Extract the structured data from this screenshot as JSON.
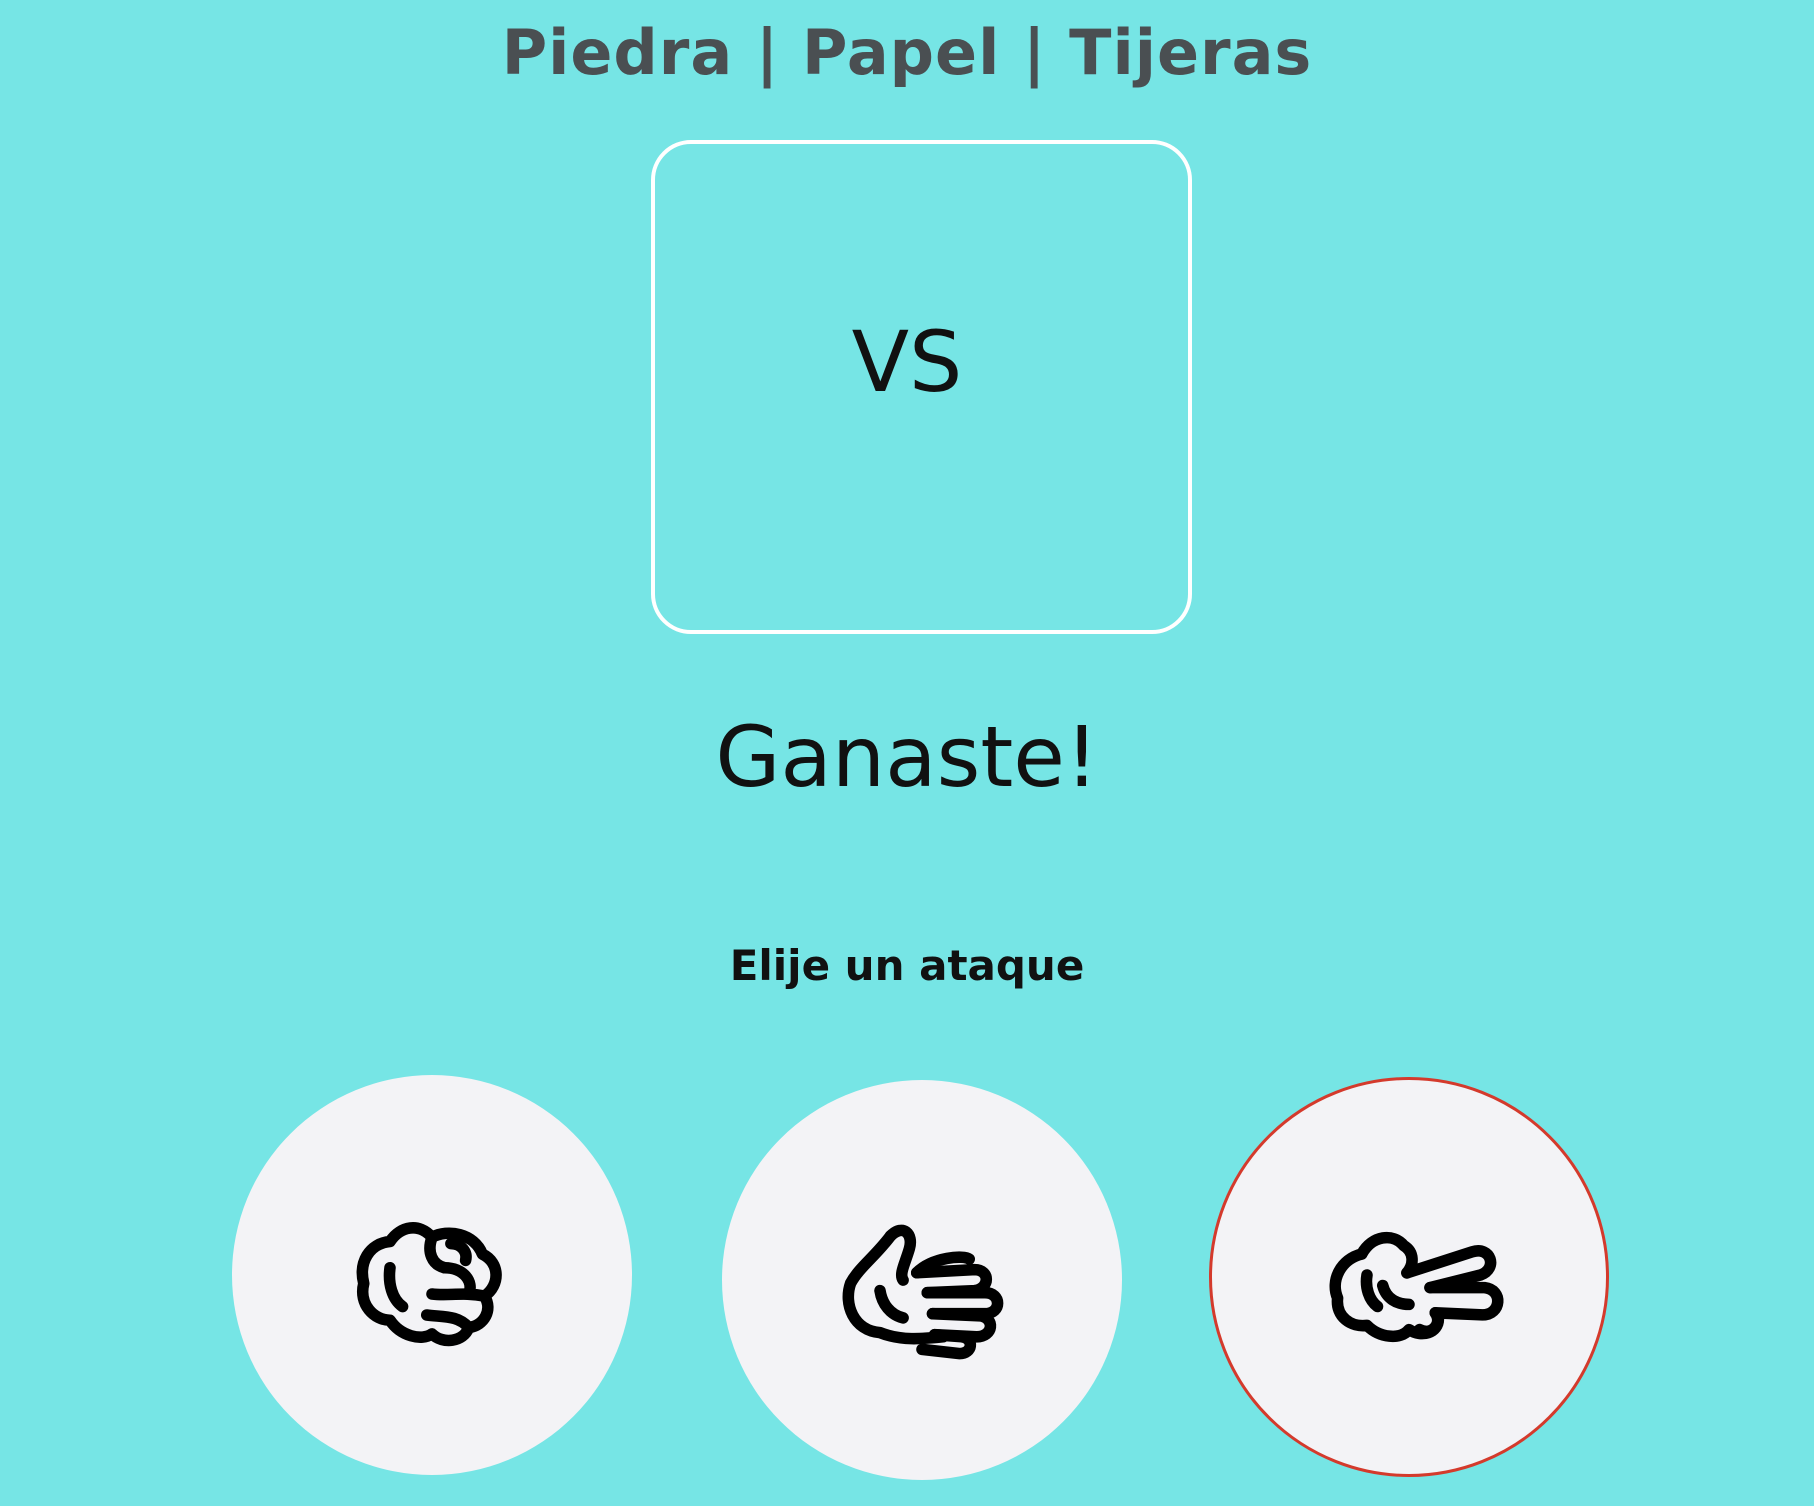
{
  "header": {
    "title": "Piedra | Papel | Tijeras"
  },
  "arena": {
    "vs_label": "VS"
  },
  "result": {
    "message": "Ganaste!"
  },
  "attacks": {
    "prompt": "Elije un ataque",
    "options": [
      {
        "icon": "rock-hand-icon",
        "selected": false
      },
      {
        "icon": "paper-hand-icon",
        "selected": false
      },
      {
        "icon": "scissors-hand-icon",
        "selected": true
      }
    ]
  },
  "colors": {
    "background": "#76e5e5",
    "title": "#4a4f52",
    "choice_bg": "#f3f3f6",
    "selected_border": "#d43a2c",
    "box_border": "#ffffff"
  }
}
